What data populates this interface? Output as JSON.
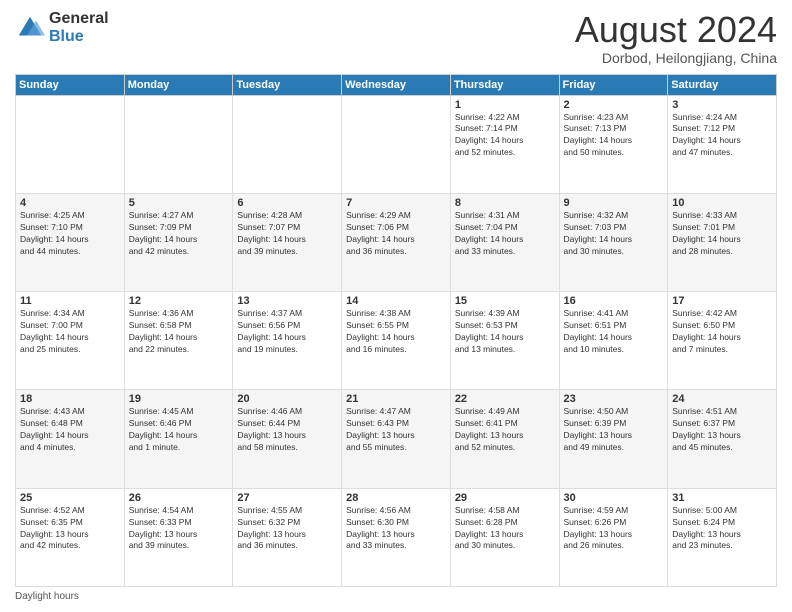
{
  "logo": {
    "general": "General",
    "blue": "Blue"
  },
  "header": {
    "month": "August 2024",
    "location": "Dorbod, Heilongjiang, China"
  },
  "days_of_week": [
    "Sunday",
    "Monday",
    "Tuesday",
    "Wednesday",
    "Thursday",
    "Friday",
    "Saturday"
  ],
  "footer": {
    "daylight_label": "Daylight hours"
  },
  "weeks": [
    [
      {
        "day": "",
        "info": ""
      },
      {
        "day": "",
        "info": ""
      },
      {
        "day": "",
        "info": ""
      },
      {
        "day": "",
        "info": ""
      },
      {
        "day": "1",
        "info": "Sunrise: 4:22 AM\nSunset: 7:14 PM\nDaylight: 14 hours\nand 52 minutes."
      },
      {
        "day": "2",
        "info": "Sunrise: 4:23 AM\nSunset: 7:13 PM\nDaylight: 14 hours\nand 50 minutes."
      },
      {
        "day": "3",
        "info": "Sunrise: 4:24 AM\nSunset: 7:12 PM\nDaylight: 14 hours\nand 47 minutes."
      }
    ],
    [
      {
        "day": "4",
        "info": "Sunrise: 4:25 AM\nSunset: 7:10 PM\nDaylight: 14 hours\nand 44 minutes."
      },
      {
        "day": "5",
        "info": "Sunrise: 4:27 AM\nSunset: 7:09 PM\nDaylight: 14 hours\nand 42 minutes."
      },
      {
        "day": "6",
        "info": "Sunrise: 4:28 AM\nSunset: 7:07 PM\nDaylight: 14 hours\nand 39 minutes."
      },
      {
        "day": "7",
        "info": "Sunrise: 4:29 AM\nSunset: 7:06 PM\nDaylight: 14 hours\nand 36 minutes."
      },
      {
        "day": "8",
        "info": "Sunrise: 4:31 AM\nSunset: 7:04 PM\nDaylight: 14 hours\nand 33 minutes."
      },
      {
        "day": "9",
        "info": "Sunrise: 4:32 AM\nSunset: 7:03 PM\nDaylight: 14 hours\nand 30 minutes."
      },
      {
        "day": "10",
        "info": "Sunrise: 4:33 AM\nSunset: 7:01 PM\nDaylight: 14 hours\nand 28 minutes."
      }
    ],
    [
      {
        "day": "11",
        "info": "Sunrise: 4:34 AM\nSunset: 7:00 PM\nDaylight: 14 hours\nand 25 minutes."
      },
      {
        "day": "12",
        "info": "Sunrise: 4:36 AM\nSunset: 6:58 PM\nDaylight: 14 hours\nand 22 minutes."
      },
      {
        "day": "13",
        "info": "Sunrise: 4:37 AM\nSunset: 6:56 PM\nDaylight: 14 hours\nand 19 minutes."
      },
      {
        "day": "14",
        "info": "Sunrise: 4:38 AM\nSunset: 6:55 PM\nDaylight: 14 hours\nand 16 minutes."
      },
      {
        "day": "15",
        "info": "Sunrise: 4:39 AM\nSunset: 6:53 PM\nDaylight: 14 hours\nand 13 minutes."
      },
      {
        "day": "16",
        "info": "Sunrise: 4:41 AM\nSunset: 6:51 PM\nDaylight: 14 hours\nand 10 minutes."
      },
      {
        "day": "17",
        "info": "Sunrise: 4:42 AM\nSunset: 6:50 PM\nDaylight: 14 hours\nand 7 minutes."
      }
    ],
    [
      {
        "day": "18",
        "info": "Sunrise: 4:43 AM\nSunset: 6:48 PM\nDaylight: 14 hours\nand 4 minutes."
      },
      {
        "day": "19",
        "info": "Sunrise: 4:45 AM\nSunset: 6:46 PM\nDaylight: 14 hours\nand 1 minute."
      },
      {
        "day": "20",
        "info": "Sunrise: 4:46 AM\nSunset: 6:44 PM\nDaylight: 13 hours\nand 58 minutes."
      },
      {
        "day": "21",
        "info": "Sunrise: 4:47 AM\nSunset: 6:43 PM\nDaylight: 13 hours\nand 55 minutes."
      },
      {
        "day": "22",
        "info": "Sunrise: 4:49 AM\nSunset: 6:41 PM\nDaylight: 13 hours\nand 52 minutes."
      },
      {
        "day": "23",
        "info": "Sunrise: 4:50 AM\nSunset: 6:39 PM\nDaylight: 13 hours\nand 49 minutes."
      },
      {
        "day": "24",
        "info": "Sunrise: 4:51 AM\nSunset: 6:37 PM\nDaylight: 13 hours\nand 45 minutes."
      }
    ],
    [
      {
        "day": "25",
        "info": "Sunrise: 4:52 AM\nSunset: 6:35 PM\nDaylight: 13 hours\nand 42 minutes."
      },
      {
        "day": "26",
        "info": "Sunrise: 4:54 AM\nSunset: 6:33 PM\nDaylight: 13 hours\nand 39 minutes."
      },
      {
        "day": "27",
        "info": "Sunrise: 4:55 AM\nSunset: 6:32 PM\nDaylight: 13 hours\nand 36 minutes."
      },
      {
        "day": "28",
        "info": "Sunrise: 4:56 AM\nSunset: 6:30 PM\nDaylight: 13 hours\nand 33 minutes."
      },
      {
        "day": "29",
        "info": "Sunrise: 4:58 AM\nSunset: 6:28 PM\nDaylight: 13 hours\nand 30 minutes."
      },
      {
        "day": "30",
        "info": "Sunrise: 4:59 AM\nSunset: 6:26 PM\nDaylight: 13 hours\nand 26 minutes."
      },
      {
        "day": "31",
        "info": "Sunrise: 5:00 AM\nSunset: 6:24 PM\nDaylight: 13 hours\nand 23 minutes."
      }
    ]
  ]
}
